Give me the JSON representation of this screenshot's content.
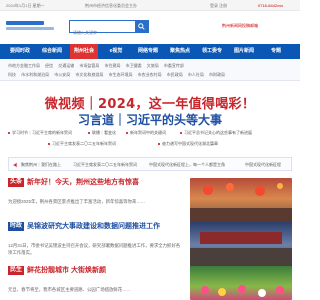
{
  "topbar": {
    "date": "2024年1月1日 星期一",
    "left_links": "荆州市经济信息化委员会主办",
    "right_1": "登录 注册",
    "right_2": "0716-8442xxx"
  },
  "header": {
    "search_placeholder": "请输入关键字",
    "right_text": "荆州新闻网投稿邮箱"
  },
  "nav": {
    "items": [
      "要闻时政",
      "综合新闻",
      "荆州社会",
      "e视觉",
      "网络专题",
      "聚焦热点",
      "领工委专",
      "图片新闻",
      "专题"
    ]
  },
  "subnav": {
    "row1": [
      "市地方金融工作局",
      "经信",
      "交通运输",
      "市场监管局",
      "市住建局",
      "市卫健委",
      "文旅局",
      "市委宣传部"
    ],
    "row2": [
      "科技",
      "市水利和湖泊局",
      "市公安局",
      "市文化和旅游局",
      "市生态环境局",
      "市农业农村局",
      "市民政局",
      "市人社局",
      "市财政局"
    ]
  },
  "banner": {
    "line1": "微视频｜2024，这一年值得喝彩！",
    "line2": "习言道｜习近平的头等大事"
  },
  "headlines_1": [
    "学习时节｜习近平主席的新年贺词",
    "联播｜看变化",
    "新年贺词中的关键词",
    "习近平总书记关心的这些事有了新进展"
  ],
  "headlines_2": [
    "习近平主席发表二〇二五年新年贺词",
    "奋力谱写中国式现代化湖北篇章"
  ],
  "ticker": [
    "聚焦荆州｜我们在路上",
    "习近平主席发表二〇二五年新年贺词",
    "中国式现代化新征程上，每一个人都是主角",
    "中国式现代化新征程"
  ],
  "news": [
    {
      "tag": "头条",
      "title": "新年好！今天，荆州这些地方有惊喜",
      "desc": "为迎接2025年，荆州各景区景点推出了丰富活动，新年惊喜等你来……"
    },
    {
      "tag": "时政",
      "title": "吴锦波研究大事政建设和数据问题推进工作",
      "desc": "12月31日，市委书记吴锦波主持召开会议，研究部署数据问题推进工作，要求全力抓好各项工作落实。"
    },
    {
      "tag": "民生",
      "title": "鲜花扮靓城市 大街焕新颜",
      "desc": "元旦、春节将至，我市各城区主要道路、公园广场摆放鲜花……"
    }
  ],
  "colors": {
    "nav_bg": "#0b57b5",
    "accent_red": "#c8252c",
    "accent_blue": "#1e4fa3"
  }
}
